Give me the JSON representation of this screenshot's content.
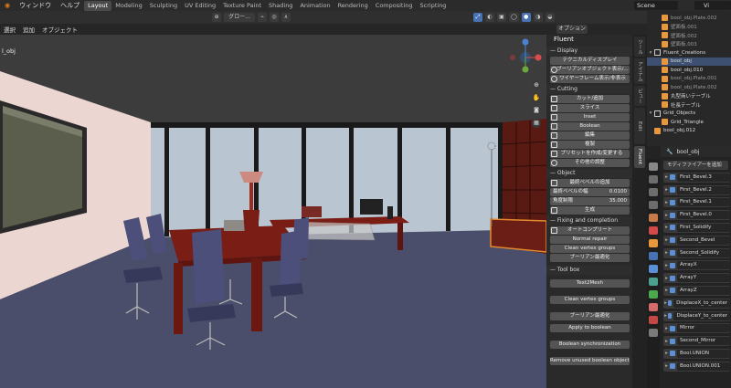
{
  "menubar": {
    "window": "ウィンドウ",
    "help": "ヘルプ",
    "workspaces": [
      "Layout",
      "Modeling",
      "Sculpting",
      "UV Editing",
      "Texture Paint",
      "Shading",
      "Animation",
      "Rendering",
      "Compositing",
      "Scripting"
    ],
    "scene": "Scene",
    "view_layer": "Vi"
  },
  "viewport_header": {
    "transform_orientation": "グロー...",
    "options": "オプション",
    "select": "選択",
    "add": "追加",
    "object": "オブジェクト",
    "object_label": "l_obj"
  },
  "tabs": [
    "ツール",
    "アイテム",
    "ビュー",
    "Edit",
    "Fluent"
  ],
  "fluent": {
    "title": "Fluent",
    "display": {
      "label": "Display",
      "buttons": [
        "テクニカルディスプレイ",
        "ブーリアンオブジェクト表示/...",
        "ワイヤーフレーム表示/非表示"
      ]
    },
    "cutting": {
      "label": "Cutting",
      "buttons": [
        "カット/追加",
        "スライス",
        "Inset",
        "Boolean",
        "編集",
        "複製",
        "プリセットを作成/変更する",
        "その他の調整"
      ]
    },
    "object": {
      "label": "Object",
      "buttons": [
        "最終ベベルの追加"
      ],
      "fields": [
        {
          "label": "最終ベベルの幅",
          "value": "0.0100"
        },
        {
          "label": "角度制限",
          "value": "35.000"
        }
      ],
      "generate": "生成"
    },
    "fixing": {
      "label": "Fixing and completion",
      "buttons": [
        "オートコンプリート",
        "Normal repair",
        "Clean vertex groups",
        "ブーリアン最適化"
      ]
    },
    "toolbox": {
      "label": "Tool box",
      "buttons": [
        "Text2Mesh",
        "Clean vertex groups",
        "ブーリアン最適化",
        "Apply to boolean",
        "Boolean synchronization",
        "Remove unused boolean objects"
      ]
    }
  },
  "outliner": {
    "rows": [
      {
        "name": "bool_obj.Plate.002",
        "indent": 2,
        "dim": true
      },
      {
        "name": "壁面板.001",
        "indent": 2,
        "dim": true
      },
      {
        "name": "壁面板.002",
        "indent": 2,
        "dim": true
      },
      {
        "name": "壁面板.003",
        "indent": 2,
        "dim": true
      },
      {
        "name": "Fluent_Creations",
        "indent": 1,
        "dim": false
      },
      {
        "name": "bool_obj",
        "indent": 2,
        "dim": false,
        "selected": true
      },
      {
        "name": "bool_obj.010",
        "indent": 2,
        "dim": false
      },
      {
        "name": "bool_obj.Plate.001",
        "indent": 2,
        "dim": true
      },
      {
        "name": "bool_obj.Plate.002",
        "indent": 2,
        "dim": true
      },
      {
        "name": "丸型商いテーブル",
        "indent": 2,
        "dim": false
      },
      {
        "name": "社長テーブル",
        "indent": 2,
        "dim": false
      },
      {
        "name": "Grid_Objects",
        "indent": 1,
        "dim": false
      },
      {
        "name": "Grid_Triangle",
        "indent": 2,
        "dim": false
      },
      {
        "name": "bool_obj.012",
        "indent": 1,
        "dim": false
      }
    ]
  },
  "properties": {
    "object_name": "bool_obj",
    "add_modifier": "モディファイアーを追加",
    "modifiers": [
      "First_Bevel.3",
      "First_Bevel.2",
      "First_Bevel.1",
      "First_Bevel.0",
      "First_Solidify",
      "Second_Bevel",
      "Second_Solidify",
      "ArrayX",
      "ArrayY",
      "ArrayZ",
      "DisplaceX_to_center",
      "DisplaceY_to_center",
      "Mirror",
      "Second_Mirror",
      "Bool.UNION",
      "Bool.UNION.001"
    ]
  },
  "colors": {
    "accent": "#4772b3",
    "selection": "#3d5071",
    "floor": "#4a4e6a",
    "furniture": "#7a1d14"
  }
}
